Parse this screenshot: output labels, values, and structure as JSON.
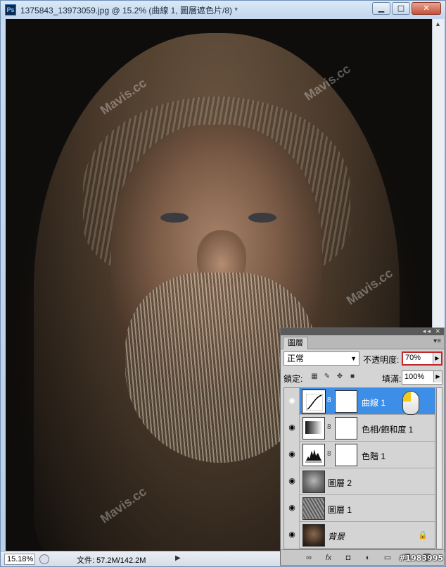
{
  "window": {
    "app_icon": "Ps",
    "title": "1375843_13973059.jpg @ 15.2% (曲線 1, 圖層遮色片/8) *",
    "minimize": "▁",
    "maximize": "□",
    "close": "✕"
  },
  "canvas": {
    "watermark": "Mavis.cc"
  },
  "statusbar": {
    "zoom": "15.18%",
    "doc_info": "文件: 57.2M/142.2M",
    "arrow": "▶"
  },
  "credit": "#1983995",
  "layers_panel": {
    "collapse_icon": "◂◂ ✕",
    "tab": "圖層",
    "menu_icon": "▾≡",
    "blend_mode": "正常",
    "opacity_label": "不透明度:",
    "opacity_value": "70%",
    "lock_label": "鎖定:",
    "fill_label": "填滿:",
    "fill_value": "100%",
    "layers": [
      {
        "name": "曲線 1",
        "type": "curves-adjustment",
        "selected": true
      },
      {
        "name": "色相/飽和度 1",
        "type": "hue-saturation-adjustment",
        "selected": false
      },
      {
        "name": "色階 1",
        "type": "levels-adjustment",
        "selected": false
      },
      {
        "name": "圖層 2",
        "type": "pixel",
        "selected": false
      },
      {
        "name": "圖層 1",
        "type": "pixel",
        "selected": false
      },
      {
        "name": "背景",
        "type": "background",
        "selected": false
      }
    ],
    "bottom_icons": [
      "link-icon",
      "fx-icon",
      "mask-icon",
      "adjustment-icon",
      "group-icon",
      "new-layer-icon",
      "trash-icon"
    ]
  },
  "colors": {
    "selection_blue": "#3d8ee6",
    "highlight_red": "#c0282a",
    "panel_gray": "#d4d4d4"
  }
}
